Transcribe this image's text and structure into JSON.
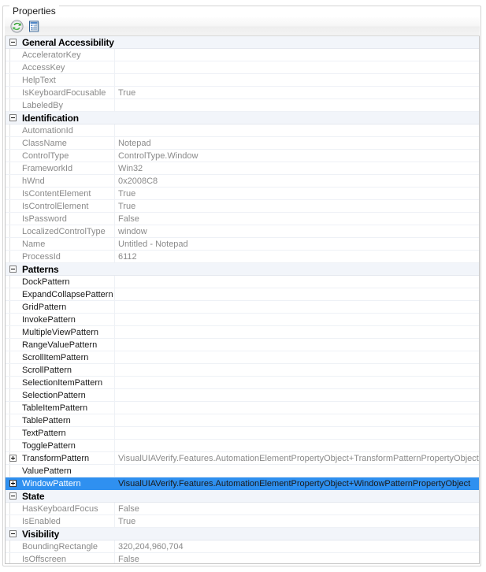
{
  "panel": {
    "title": "Properties"
  },
  "toolbar": {
    "buttons": [
      {
        "name": "refresh-icon",
        "label": "Refresh"
      },
      {
        "name": "properties-list-icon",
        "label": "Properties List"
      }
    ]
  },
  "colors": {
    "selection": "#2f90f0",
    "category_background": "#f2f5fa",
    "name_text": "#8a8a8a",
    "value_text": "#8a8a8a"
  },
  "grid": {
    "sections": [
      {
        "id": "general-accessibility",
        "label": "General Accessibility",
        "expanded": true,
        "rows": [
          {
            "name": "AcceleratorKey",
            "value": "",
            "dark": false,
            "expandable": false,
            "selected": false
          },
          {
            "name": "AccessKey",
            "value": "",
            "dark": false,
            "expandable": false,
            "selected": false
          },
          {
            "name": "HelpText",
            "value": "",
            "dark": false,
            "expandable": false,
            "selected": false
          },
          {
            "name": "IsKeyboardFocusable",
            "value": "True",
            "dark": false,
            "expandable": false,
            "selected": false
          },
          {
            "name": "LabeledBy",
            "value": "",
            "dark": false,
            "expandable": false,
            "selected": false
          }
        ]
      },
      {
        "id": "identification",
        "label": "Identification",
        "expanded": true,
        "rows": [
          {
            "name": "AutomationId",
            "value": "",
            "dark": false,
            "expandable": false,
            "selected": false
          },
          {
            "name": "ClassName",
            "value": "Notepad",
            "dark": false,
            "expandable": false,
            "selected": false
          },
          {
            "name": "ControlType",
            "value": "ControlType.Window",
            "dark": false,
            "expandable": false,
            "selected": false
          },
          {
            "name": "FrameworkId",
            "value": "Win32",
            "dark": false,
            "expandable": false,
            "selected": false
          },
          {
            "name": "hWnd",
            "value": "0x2008C8",
            "dark": false,
            "expandable": false,
            "selected": false
          },
          {
            "name": "IsContentElement",
            "value": "True",
            "dark": false,
            "expandable": false,
            "selected": false
          },
          {
            "name": "IsControlElement",
            "value": "True",
            "dark": false,
            "expandable": false,
            "selected": false
          },
          {
            "name": "IsPassword",
            "value": "False",
            "dark": false,
            "expandable": false,
            "selected": false
          },
          {
            "name": "LocalizedControlType",
            "value": "window",
            "dark": false,
            "expandable": false,
            "selected": false
          },
          {
            "name": "Name",
            "value": "Untitled - Notepad",
            "dark": false,
            "expandable": false,
            "selected": false
          },
          {
            "name": "ProcessId",
            "value": "6112",
            "dark": false,
            "expandable": false,
            "selected": false
          }
        ]
      },
      {
        "id": "patterns",
        "label": "Patterns",
        "expanded": true,
        "rows": [
          {
            "name": "DockPattern",
            "value": "",
            "dark": true,
            "expandable": false,
            "selected": false
          },
          {
            "name": "ExpandCollapsePattern",
            "value": "",
            "dark": true,
            "expandable": false,
            "selected": false
          },
          {
            "name": "GridPattern",
            "value": "",
            "dark": true,
            "expandable": false,
            "selected": false
          },
          {
            "name": "InvokePattern",
            "value": "",
            "dark": true,
            "expandable": false,
            "selected": false
          },
          {
            "name": "MultipleViewPattern",
            "value": "",
            "dark": true,
            "expandable": false,
            "selected": false
          },
          {
            "name": "RangeValuePattern",
            "value": "",
            "dark": true,
            "expandable": false,
            "selected": false
          },
          {
            "name": "ScrollItemPattern",
            "value": "",
            "dark": true,
            "expandable": false,
            "selected": false
          },
          {
            "name": "ScrollPattern",
            "value": "",
            "dark": true,
            "expandable": false,
            "selected": false
          },
          {
            "name": "SelectionItemPattern",
            "value": "",
            "dark": true,
            "expandable": false,
            "selected": false
          },
          {
            "name": "SelectionPattern",
            "value": "",
            "dark": true,
            "expandable": false,
            "selected": false
          },
          {
            "name": "TableItemPattern",
            "value": "",
            "dark": true,
            "expandable": false,
            "selected": false
          },
          {
            "name": "TablePattern",
            "value": "",
            "dark": true,
            "expandable": false,
            "selected": false
          },
          {
            "name": "TextPattern",
            "value": "",
            "dark": true,
            "expandable": false,
            "selected": false
          },
          {
            "name": "TogglePattern",
            "value": "",
            "dark": true,
            "expandable": false,
            "selected": false
          },
          {
            "name": "TransformPattern",
            "value": "VisualUIAVerify.Features.AutomationElementPropertyObject+TransformPatternPropertyObject",
            "dark": true,
            "expandable": true,
            "selected": false
          },
          {
            "name": "ValuePattern",
            "value": "",
            "dark": true,
            "expandable": false,
            "selected": false
          },
          {
            "name": "WindowPattern",
            "value": "VisualUIAVerify.Features.AutomationElementPropertyObject+WindowPatternPropertyObject",
            "dark": true,
            "expandable": true,
            "selected": true
          }
        ]
      },
      {
        "id": "state",
        "label": "State",
        "expanded": true,
        "rows": [
          {
            "name": "HasKeyboardFocus",
            "value": "False",
            "dark": false,
            "expandable": false,
            "selected": false
          },
          {
            "name": "IsEnabled",
            "value": "True",
            "dark": false,
            "expandable": false,
            "selected": false
          }
        ]
      },
      {
        "id": "visibility",
        "label": "Visibility",
        "expanded": true,
        "rows": [
          {
            "name": "BoundingRectangle",
            "value": "320,204,960,704",
            "dark": false,
            "expandable": false,
            "selected": false
          },
          {
            "name": "IsOffscreen",
            "value": "False",
            "dark": false,
            "expandable": false,
            "selected": false
          }
        ]
      }
    ]
  }
}
